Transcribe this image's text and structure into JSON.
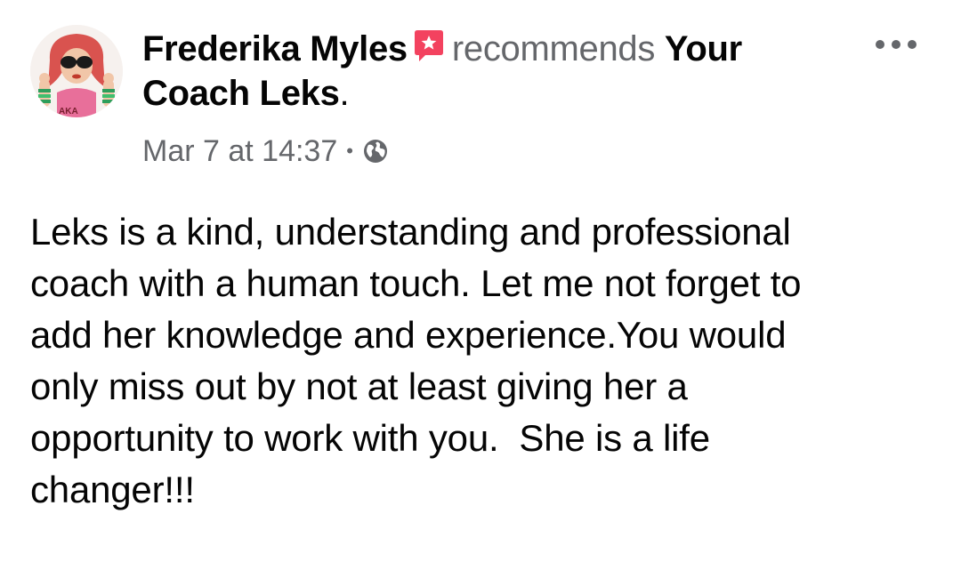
{
  "post": {
    "author": "Frederika Myles",
    "verb": "recommends",
    "page_name_line1": "Your",
    "page_name_line2": "Coach Leks",
    "period": ".",
    "timestamp": "Mar 7 at 14:37",
    "separator": "•",
    "privacy_icon": "globe-icon",
    "recommendation_icon": "recommendation-star-icon",
    "more_icon": "more-options-icon",
    "body": "Leks is a kind, understanding and professional\ncoach with a human touch. Let me not forget to\nadd her knowledge and experience.You would\nonly miss out by not at least giving her a\nopportunity to work with you.  She is a life\nchanger!!!",
    "avatar_text": "AKA"
  },
  "colors": {
    "primary_text": "#050505",
    "secondary_text": "#65676b",
    "recommendation_red": "#f3425f",
    "background": "#ffffff"
  }
}
